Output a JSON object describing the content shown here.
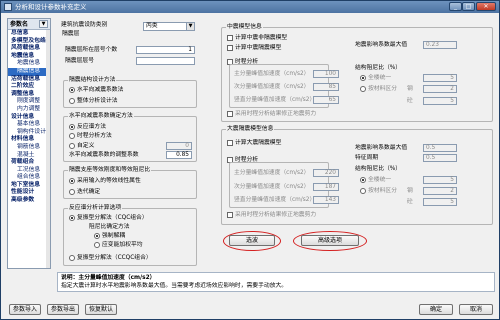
{
  "window": {
    "title": "分析和设计参数补充定义",
    "minimize": "_",
    "maximize": "□",
    "close": "✕"
  },
  "sidebar": {
    "header": "参数名",
    "items": [
      {
        "label": "总信息",
        "level": 1
      },
      {
        "label": "多模型及包络",
        "level": 1
      },
      {
        "label": "风荷载信息",
        "level": 1
      },
      {
        "label": "地震信息",
        "level": 1
      },
      {
        "label": "地震信息",
        "level": 2
      },
      {
        "label": "隔震信息",
        "level": 2,
        "selected": true
      },
      {
        "label": "活荷载信息",
        "level": 1
      },
      {
        "label": "二阶效应",
        "level": 1
      },
      {
        "label": "调整信息",
        "level": 1
      },
      {
        "label": "刚度调整",
        "level": 2
      },
      {
        "label": "内力调整",
        "level": 2
      },
      {
        "label": "设计信息",
        "level": 1
      },
      {
        "label": "基本信息",
        "level": 2
      },
      {
        "label": "钢构件设计",
        "level": 2
      },
      {
        "label": "材料信息",
        "level": 1
      },
      {
        "label": "钢筋信息",
        "level": 2
      },
      {
        "label": "混凝土",
        "level": 2
      },
      {
        "label": "荷载组合",
        "level": 1
      },
      {
        "label": "工况信息",
        "level": 2
      },
      {
        "label": "组合信息",
        "level": 2
      },
      {
        "label": "地下室信息",
        "level": 1
      },
      {
        "label": "性能设计",
        "level": 1
      },
      {
        "label": "高级参数",
        "level": 1
      }
    ]
  },
  "left": {
    "seismic_type_label": "建筑抗震设防类别",
    "seismic_type_value": "丙类",
    "iso_layer_label": "隔震层",
    "iso_count_label": "隔震层所在层号个数",
    "iso_count_value": "1",
    "iso_floor_label": "隔震层层号",
    "iso_floor_value": "",
    "method_group": "隔震结构设计方法",
    "method_opt1": "水平向减震系数法",
    "method_opt2": "整体分析设计法",
    "damping_group": "水平向减震系数确定方法",
    "damp_opt1": "反应谱方法",
    "damp_opt2": "时程分析方法",
    "damp_opt3": "自定义",
    "damp_value1": "0",
    "damp_value_label": "水平向减震系数的调整系数",
    "damp_value2": "0.85",
    "support_group": "隔震支座等效刚度和等效阻尼比",
    "support_opt1": "采用输入的等效线性属性",
    "support_opt2": "迭代确定",
    "response_group": "反应谱分析计算选项",
    "resp_opt1": "复振型分解法（CQC组合）",
    "resp_sub": "阻尼比确定方法",
    "resp_sub1": "强制解耦",
    "resp_sub2": "应变能加权平均",
    "resp_opt2": "复振型分解法（CCQC组合）"
  },
  "middle": {
    "mid_group": "中震模型信息",
    "mid_chk1": "计算中震非隔震模型",
    "mid_chk2": "计算中震隔震模型",
    "mid_th": "时程分析",
    "mid_a1_label": "主分量峰值加速度（cm/s2）",
    "mid_a1": "100",
    "mid_a2_label": "次分量峰值加速度（cm/s2）",
    "mid_a2": "85",
    "mid_a3_label": "竖直分量峰值加速度（cm/s2）",
    "mid_a3": "65",
    "mid_chk3": "采用时程分析结果修正地震剪力",
    "big_group": "大震隔震模型信息",
    "big_chk1": "计算大震隔震模型",
    "big_th": "时程分析",
    "big_a1_label": "主分量峰值加速度（cm/s2）",
    "big_a1": "220",
    "big_a2_label": "次分量峰值加速度（cm/s2）",
    "big_a2": "187",
    "big_a3_label": "竖直分量峰值加速度（cm/s2）",
    "big_a3": "143",
    "big_chk3": "采用时程分析结果修正地震剪力",
    "select_btn": "选波",
    "advanced_btn": "高级选项"
  },
  "right": {
    "mid_acc_label": "地震影响系数最大值",
    "mid_acc": "0.23",
    "damp_group": "结构阻尼比（%）",
    "r_all": "全楼统一",
    "r_all_val": "5",
    "r_mat": "按材料区分",
    "steel": "钢",
    "steel_val": "2",
    "conc": "砼",
    "conc_val": "5",
    "big_acc_label": "地震影响系数最大值",
    "big_acc": "0.5",
    "period_label": "特征周期",
    "period": "0.5",
    "big_damp": "结构阻尼比（%）",
    "b_all": "全楼统一",
    "b_all_val": "5",
    "b_mat": "按材料区分",
    "b_steel": "钢",
    "b_steel_val": "2",
    "b_conc": "砼",
    "b_conc_val": "5"
  },
  "status": {
    "title": "说明：主分量峰值加速度（cm/s2）",
    "text": "指定大震计算时水平地震影响系数最大值。当需要考虑近场效应影响时，需要手动放大。"
  },
  "footer": {
    "import": "参数导入",
    "export": "参数导出",
    "restore": "恢复默认",
    "ok": "确定",
    "cancel": "取消"
  }
}
